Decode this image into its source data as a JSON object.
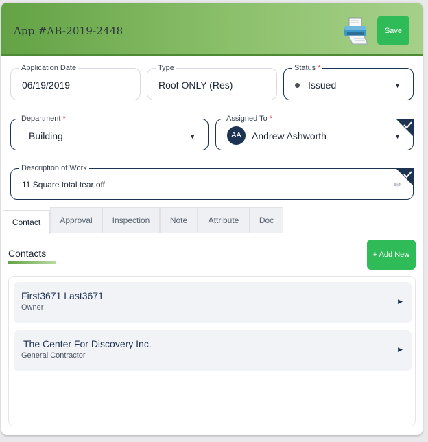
{
  "header": {
    "title": "App #AB-2019-2448",
    "print_icon": "printer-icon",
    "save_label": "Save"
  },
  "fields": {
    "application_date": {
      "label": "Application Date",
      "value": "06/19/2019"
    },
    "type": {
      "label": "Type",
      "value": "Roof ONLY (Res)"
    },
    "status": {
      "label": "Status",
      "required_mark": "*",
      "value": "Issued"
    },
    "department": {
      "label": "Department",
      "required_mark": "*",
      "value": "Building"
    },
    "assigned_to": {
      "label": "Assigned To",
      "required_mark": "*",
      "initials": "AA",
      "value": "Andrew Ashworth"
    },
    "description": {
      "label": "Description of Work",
      "value": "11 Square total tear off"
    }
  },
  "tabs": [
    {
      "label": "Contact",
      "active": true
    },
    {
      "label": "Approval"
    },
    {
      "label": "Inspection"
    },
    {
      "label": "Note"
    },
    {
      "label": "Attribute"
    },
    {
      "label": "Doc"
    }
  ],
  "contacts_section": {
    "title": "Contacts",
    "add_label": "+ Add New",
    "items": [
      {
        "name": "First3671 Last3671",
        "role": "Owner"
      },
      {
        "name": "The Center For Discovery Inc.",
        "role": "General Contractor"
      }
    ]
  },
  "colors": {
    "brand_green": "#2fbb58",
    "navy": "#1d3352",
    "required": "#e03b3b"
  }
}
